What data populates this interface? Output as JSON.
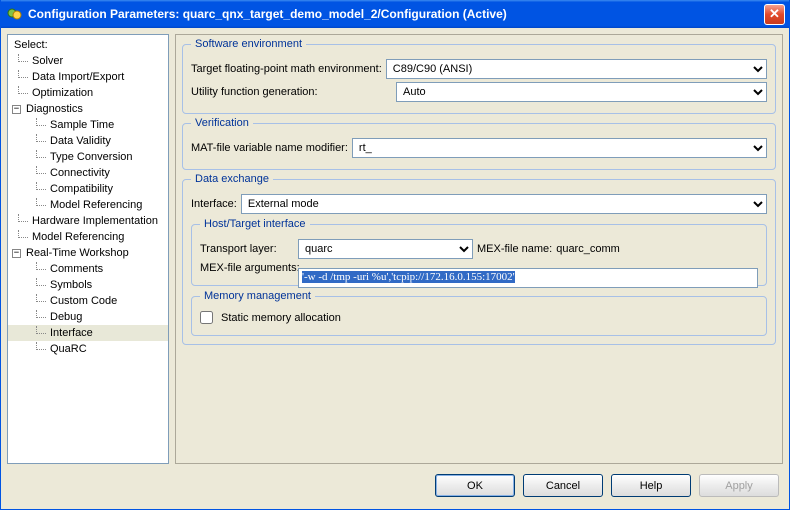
{
  "window": {
    "title": "Configuration Parameters: quarc_qnx_target_demo_model_2/Configuration (Active)"
  },
  "tree": {
    "heading": "Select:",
    "items": {
      "solver": "Solver",
      "dataio": "Data Import/Export",
      "optimization": "Optimization",
      "diagnostics": "Diagnostics",
      "sampletime": "Sample Time",
      "datavalidity": "Data Validity",
      "typeconv": "Type Conversion",
      "connectivity": "Connectivity",
      "compatibility": "Compatibility",
      "modelref": "Model Referencing",
      "hwimpl": "Hardware Implementation",
      "modelref2": "Model Referencing",
      "rtw": "Real-Time Workshop",
      "comments": "Comments",
      "symbols": "Symbols",
      "customcode": "Custom Code",
      "debug": "Debug",
      "interface": "Interface",
      "quarc": "QuaRC"
    }
  },
  "groups": {
    "swenv": {
      "legend": "Software environment",
      "target_fp": {
        "label": "Target floating-point math environment:",
        "value": "C89/C90 (ANSI)"
      },
      "utilgen": {
        "label": "Utility function generation:",
        "value": "Auto"
      }
    },
    "verif": {
      "legend": "Verification",
      "mat": {
        "label": "MAT-file variable name modifier:",
        "value": "rt_"
      }
    },
    "dataex": {
      "legend": "Data exchange",
      "iface": {
        "label": "Interface:",
        "value": "External mode"
      },
      "host": {
        "legend": "Host/Target interface",
        "transport": {
          "label": "Transport layer:",
          "value": "quarc"
        },
        "mexname": {
          "label": "MEX-file name:",
          "value": "quarc_comm"
        },
        "mexargs": {
          "label": "MEX-file arguments:",
          "value": "'-w -d /tmp -uri %u','tcpip://172.16.0.155:17002'"
        }
      },
      "mem": {
        "legend": "Memory management",
        "static": {
          "label": "Static memory allocation"
        }
      }
    }
  },
  "buttons": {
    "ok": "OK",
    "cancel": "Cancel",
    "help": "Help",
    "apply": "Apply"
  }
}
